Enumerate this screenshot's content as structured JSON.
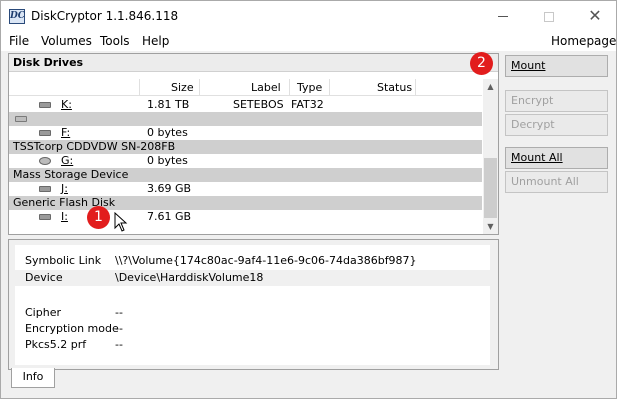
{
  "window": {
    "title": "DiskCryptor 1.1.846.118",
    "app_icon": "diskcryptor-logo-icon",
    "minimize_icon": "minimize-icon",
    "maximize_icon": "maximize-icon",
    "close_icon": "close-icon",
    "close_glyph": "✕"
  },
  "menu": {
    "items": [
      "File",
      "Volumes",
      "Tools",
      "Help"
    ],
    "homepage": "Homepage"
  },
  "drives_panel": {
    "title": "Disk Drives",
    "columns": [
      "Size",
      "Label",
      "Type",
      "Status"
    ],
    "rows": [
      {
        "kind": "volume",
        "icon": "hard-drive-icon",
        "name": "K:",
        "size": "1.81 TB",
        "label": "SETEBOS",
        "type": "FAT32",
        "status": ""
      },
      {
        "kind": "group",
        "icon": "hard-drive-icon",
        "name": ""
      },
      {
        "kind": "volume",
        "icon": "hard-drive-icon",
        "name": "F:",
        "size": "0 bytes",
        "label": "",
        "type": "",
        "status": ""
      },
      {
        "kind": "group",
        "icon": "",
        "name": "TSSTcorp CDDVDW SN-208FB"
      },
      {
        "kind": "volume",
        "icon": "cd-drive-icon",
        "name": "G:",
        "size": "0 bytes",
        "label": "",
        "type": "",
        "status": ""
      },
      {
        "kind": "group",
        "icon": "",
        "name": "Mass Storage Device"
      },
      {
        "kind": "volume",
        "icon": "hard-drive-icon",
        "name": "J:",
        "size": "3.69 GB",
        "label": "",
        "type": "",
        "status": ""
      },
      {
        "kind": "group",
        "icon": "",
        "name": "Generic Flash Disk"
      },
      {
        "kind": "volume",
        "icon": "hard-drive-icon",
        "name": "I:",
        "size": "7.61 GB",
        "label": "",
        "type": "",
        "status": ""
      }
    ],
    "scroll_up_glyph": "▲",
    "scroll_down_glyph": "▼"
  },
  "info_panel": {
    "rows": [
      {
        "key": "Symbolic Link",
        "value": "\\\\?\\Volume{174c80ac-9af4-11e6-9c06-74da386bf987}"
      },
      {
        "key": "Device",
        "value": "\\Device\\HarddiskVolume18"
      },
      {
        "key": "",
        "value": ""
      },
      {
        "key": "Cipher",
        "value": "--"
      },
      {
        "key": "Encryption mode",
        "value": "--"
      },
      {
        "key": "Pkcs5.2 prf",
        "value": "--"
      }
    ],
    "tab": "Info"
  },
  "buttons": {
    "mount": "Mount",
    "encrypt": "Encrypt",
    "decrypt": "Decrypt",
    "mount_all": "Mount All",
    "unmount_all": "Unmount All"
  },
  "annotations": {
    "badge_1": "1",
    "badge_2": "2",
    "badge_color": "#e21d1d"
  }
}
